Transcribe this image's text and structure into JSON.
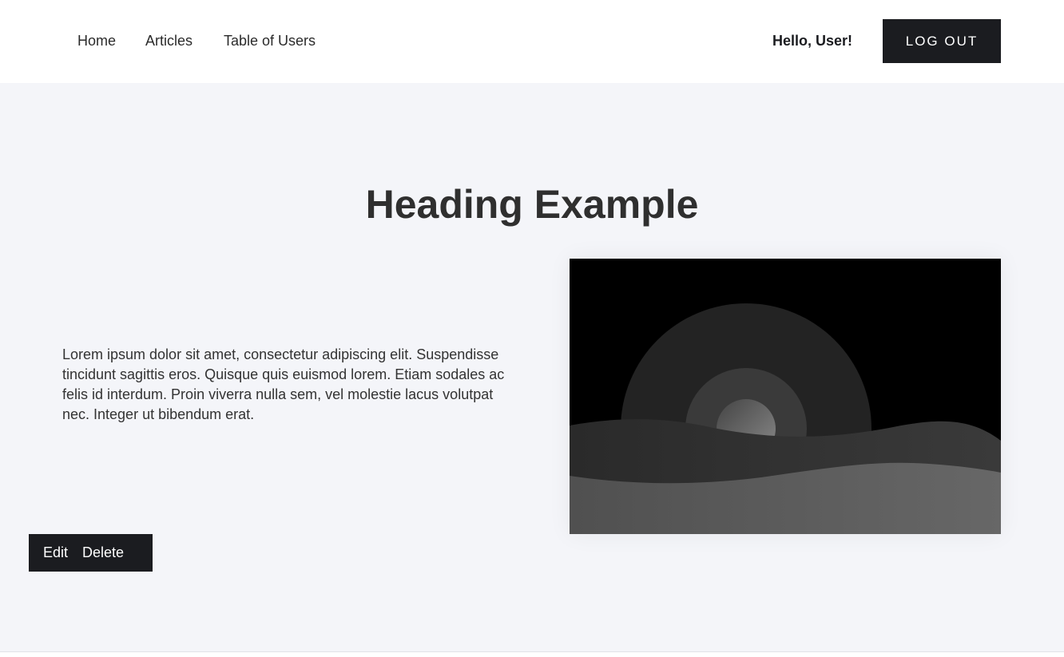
{
  "nav": {
    "links": [
      {
        "label": "Home"
      },
      {
        "label": "Articles"
      },
      {
        "label": "Table of Users"
      }
    ],
    "greeting": "Hello, User!",
    "logout_label": "LOG OUT"
  },
  "main": {
    "heading": "Heading Example",
    "body": "Lorem ipsum dolor sit amet, consectetur adipiscing elit. Suspendisse tincidunt sagittis eros. Quisque quis euismod lorem. Etiam sodales ac felis id interdum. Proin viverra nulla sem, vel molestie lacus volutpat nec. Integer ut bibendum erat.",
    "image_icon": "landscape-placeholder-image",
    "actions": {
      "edit_label": "Edit",
      "delete_label": "Delete"
    }
  },
  "colors": {
    "accent": "#1b1c20",
    "background": "#f4f5f9",
    "header_bg": "#ffffff"
  }
}
